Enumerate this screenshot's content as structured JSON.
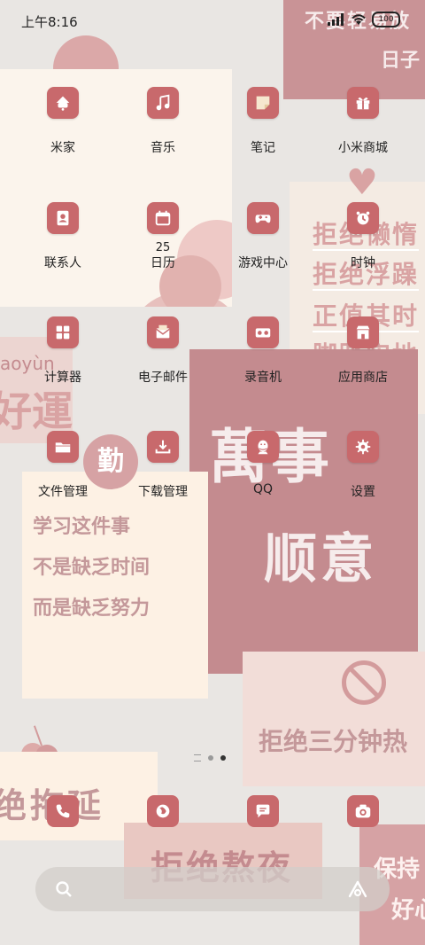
{
  "status_bar": {
    "time": "上午8:16",
    "battery": "100"
  },
  "wallpaper": {
    "top_right_line1": "不要轻易放",
    "top_right_line2": "日子",
    "right_note": [
      "拒绝懒惰",
      "拒绝浮躁",
      "正值其时",
      "脚踏实地"
    ],
    "left_pinyin": "aoyùn",
    "left_big": "好運",
    "center_big_1": "萬事",
    "center_big_2": "顺意",
    "qin": "勤",
    "memo": [
      "学习这件事",
      "不是缺乏时间",
      "而是缺乏努力"
    ],
    "no_lazy": "拒绝三分钟热",
    "no_delay": "绝拖延",
    "no_late": "拒绝熬夜",
    "keep_1": "保持",
    "keep_2": "好心"
  },
  "apps": [
    {
      "label": "米家",
      "icon": "mijia-icon"
    },
    {
      "label": "音乐",
      "icon": "music-icon"
    },
    {
      "label": "笔记",
      "icon": "notes-icon"
    },
    {
      "label": "小米商城",
      "icon": "gift-icon"
    },
    {
      "label": "联系人",
      "icon": "contacts-icon"
    },
    {
      "label": "日历",
      "icon": "calendar-icon",
      "date": "25"
    },
    {
      "label": "游戏中心",
      "icon": "gamepad-icon"
    },
    {
      "label": "时钟",
      "icon": "clock-icon"
    },
    {
      "label": "计算器",
      "icon": "calculator-icon"
    },
    {
      "label": "电子邮件",
      "icon": "mail-icon"
    },
    {
      "label": "录音机",
      "icon": "recorder-icon"
    },
    {
      "label": "应用商店",
      "icon": "store-icon"
    },
    {
      "label": "文件管理",
      "icon": "folder-icon"
    },
    {
      "label": "下载管理",
      "icon": "download-icon"
    },
    {
      "label": "QQ",
      "icon": "qq-icon"
    },
    {
      "label": "设置",
      "icon": "gear-icon"
    }
  ],
  "dock": [
    "phone-icon",
    "browser-icon",
    "messages-icon",
    "camera-icon"
  ],
  "colors": {
    "icon_bg": "#c8696c",
    "note_pink": "#c48b8f",
    "note_cream": "#fbf4ec"
  }
}
